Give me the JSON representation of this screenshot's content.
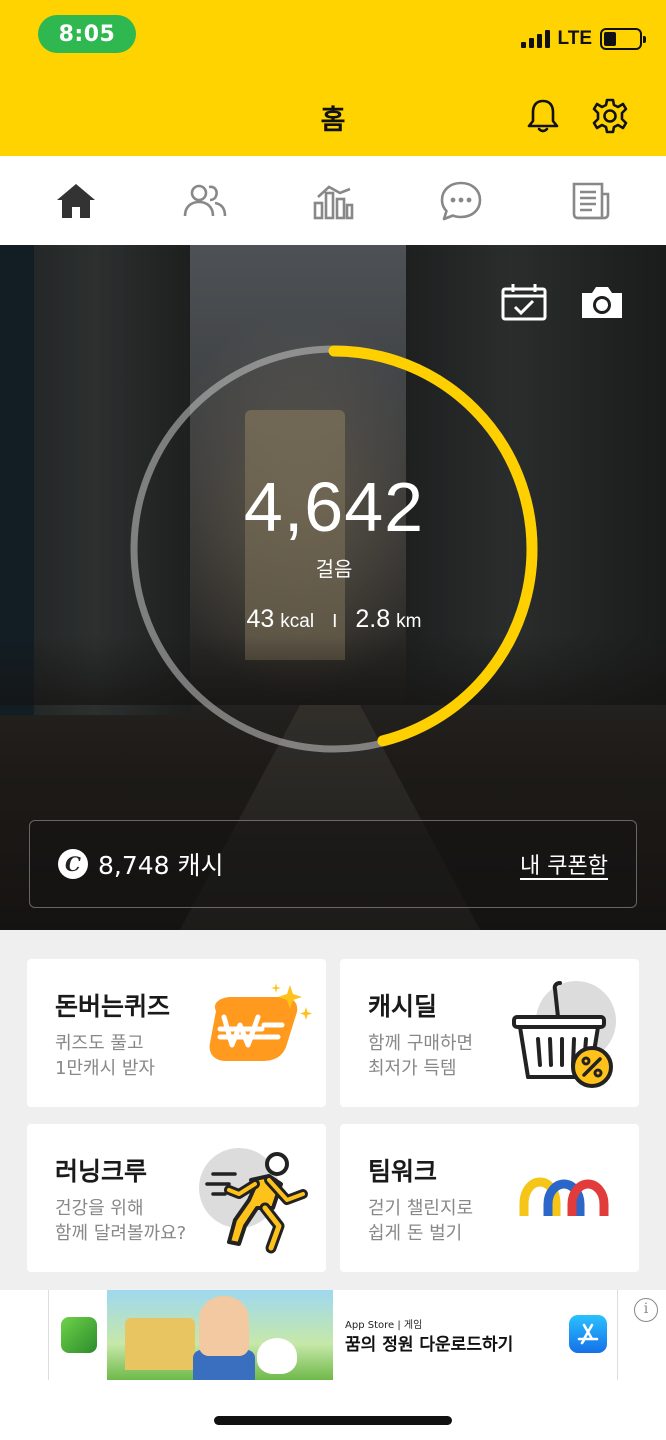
{
  "status_bar": {
    "time": "8:05",
    "network": "LTE"
  },
  "header": {
    "title": "홈",
    "icons": [
      "bell-icon",
      "gear-icon"
    ]
  },
  "tabs": [
    {
      "name": "home",
      "icon": "home-icon",
      "active": true
    },
    {
      "name": "friends",
      "icon": "people-icon",
      "active": false
    },
    {
      "name": "stats",
      "icon": "chart-icon",
      "active": false
    },
    {
      "name": "chat",
      "icon": "chat-icon",
      "active": false
    },
    {
      "name": "news",
      "icon": "newspaper-icon",
      "active": false
    }
  ],
  "hero": {
    "steps": "4,642",
    "steps_label": "걸음",
    "kcal_value": "43",
    "kcal_unit": "kcal",
    "distance_value": "2.8",
    "distance_unit": "km",
    "separator": "I",
    "progress": 0.46,
    "icons": [
      "calendar-check-icon",
      "camera-icon"
    ]
  },
  "cash": {
    "icon_letter": "C",
    "amount": "8,748 캐시",
    "coupon_link": "내 쿠폰함"
  },
  "cards": {
    "quiz": {
      "title": "돈버는퀴즈",
      "desc": "퀴즈도 풀고\n1만캐시 받자"
    },
    "deal": {
      "title": "캐시딜",
      "desc": "함께 구매하면\n최저가 득템"
    },
    "running": {
      "title": "러닝크루",
      "desc": "건강을 위해\n함께 달려볼까요?"
    },
    "teamwork": {
      "title": "팀워크",
      "desc": "걷기 챌린지로\n쉽게 돈 벌기"
    }
  },
  "ad": {
    "store_line": "App Store | 게임",
    "headline": "꿈의 정원 다운로드하기",
    "info": "i"
  },
  "colors": {
    "brand_yellow": "#fed300",
    "time_pill_green": "#2eb84f",
    "ring_yellow": "#ffd000"
  }
}
